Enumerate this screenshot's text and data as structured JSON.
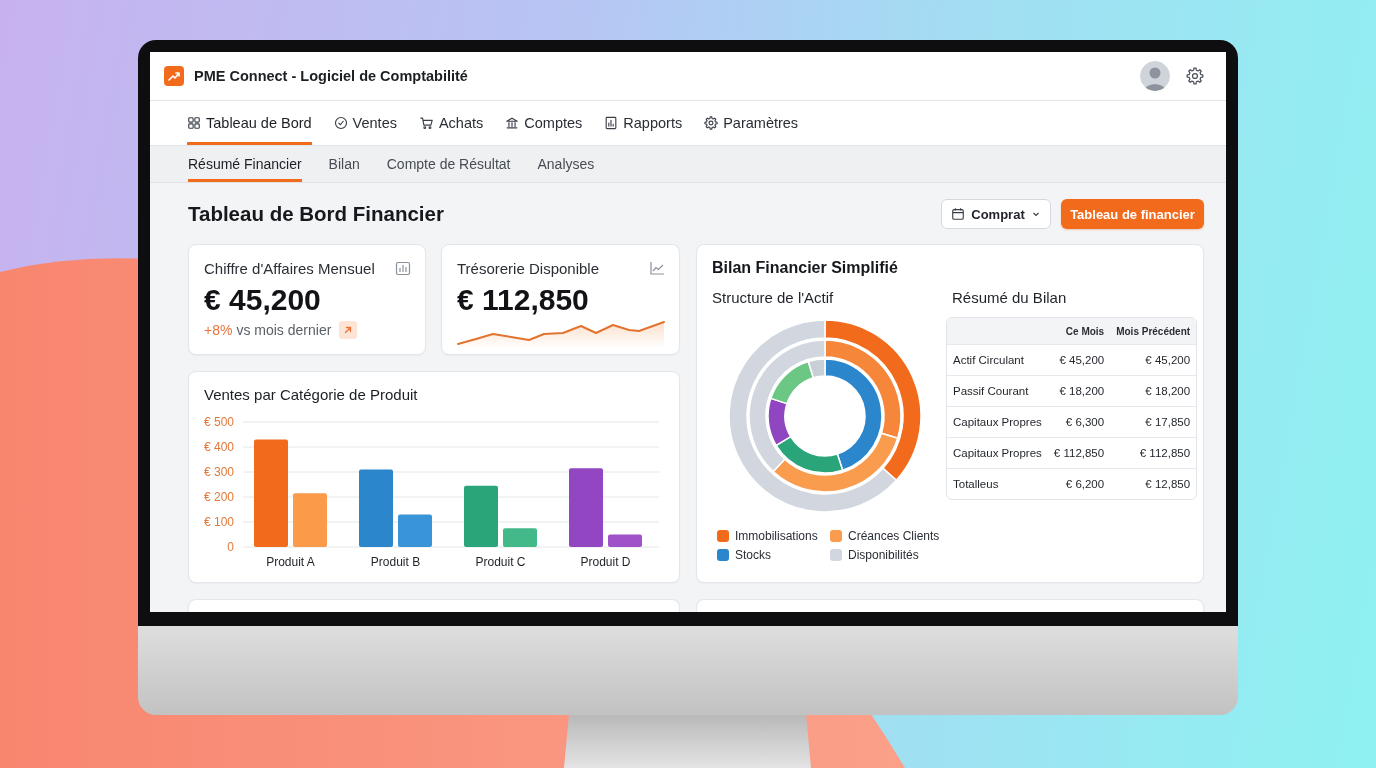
{
  "app": {
    "title": "PME Connect - Logiciel de Comptabilité"
  },
  "nav_tabs": [
    {
      "label": "Tableau de Bord",
      "selected": true
    },
    {
      "label": "Ventes",
      "selected": false
    },
    {
      "label": "Achats",
      "selected": false
    },
    {
      "label": "Comptes",
      "selected": false
    },
    {
      "label": "Rapports",
      "selected": false
    },
    {
      "label": "Paramètres",
      "selected": false
    }
  ],
  "sub_tabs": [
    {
      "label": "Résumé Financier",
      "selected": true
    },
    {
      "label": "Bilan",
      "selected": false
    },
    {
      "label": "Compte de Résultat",
      "selected": false
    },
    {
      "label": "Analyses",
      "selected": false
    }
  ],
  "page": {
    "title": "Tableau de Bord Financier",
    "period_button": "Comprat",
    "primary_button": "Tableau de financier"
  },
  "kpis": [
    {
      "kind": "trend",
      "label": "Chiffre d'Affaires Mensuel",
      "value": "€ 45,200",
      "change": "+8%",
      "change_label": "vs mois dernier"
    },
    {
      "kind": "sparkline",
      "label": "Trésorerie Disponible",
      "value": "€ 112,850"
    }
  ],
  "sales_chart": {
    "title": "Ventes par Catégorie de Produit",
    "chart_data": {
      "type": "bar",
      "grid": true,
      "categories": [
        "Produit A",
        "Produit B",
        "Produit C",
        "Produit D"
      ],
      "series": [
        {
          "colors": [
            "#f26b1d",
            "#2b86cc",
            "#2aa57a",
            "#9346c2"
          ],
          "values": [
            430,
            310,
            245,
            315
          ]
        },
        {
          "colors": [
            "#fb9a48",
            "#3a95d8",
            "#43b98a",
            "#a052c8"
          ],
          "values": [
            215,
            130,
            75,
            50
          ]
        }
      ],
      "ylim": [
        0,
        500
      ],
      "yticks": [
        0,
        {
          "value": 100,
          "label": "€ 100"
        },
        {
          "value": 200,
          "label": "€ 200"
        },
        {
          "value": 300,
          "label": "€ 300"
        },
        {
          "value": 400,
          "label": "€ 400"
        },
        {
          "value": 500,
          "label": "€ 500"
        }
      ]
    }
  },
  "balance_card": {
    "title": "Bilan Financier Simplifié",
    "structure_title": "Structure de l'Actif",
    "legend": [
      {
        "label": "Immobilisations",
        "color": "#f26b1d"
      },
      {
        "label": "Créances Clients",
        "color": "#f99c4e"
      },
      {
        "label": "Stocks",
        "color": "#2b86cc"
      },
      {
        "label": "Disponibilités",
        "color": "#d2d7df"
      }
    ],
    "summary": {
      "title": "Résumé du Bilan",
      "columns": [
        "Ce Mois",
        "Mois Précédent"
      ],
      "rows": [
        {
          "label": "Actif Circulant",
          "values": [
            "€ 45,200",
            "€ 45,200"
          ]
        },
        {
          "label": "Passif Courant",
          "values": [
            "€ 18,200",
            "€ 18,200"
          ]
        },
        {
          "label": "Capitaux Propres",
          "values": [
            "€ 6,300",
            "€ 17,850"
          ]
        },
        {
          "label": "Capitaux Propres",
          "values": [
            "€ 112,850",
            "€ 112,850"
          ]
        },
        {
          "label": "Totalleus",
          "values": [
            "€ 6,200",
            "€ 12,850"
          ]
        }
      ]
    }
  }
}
